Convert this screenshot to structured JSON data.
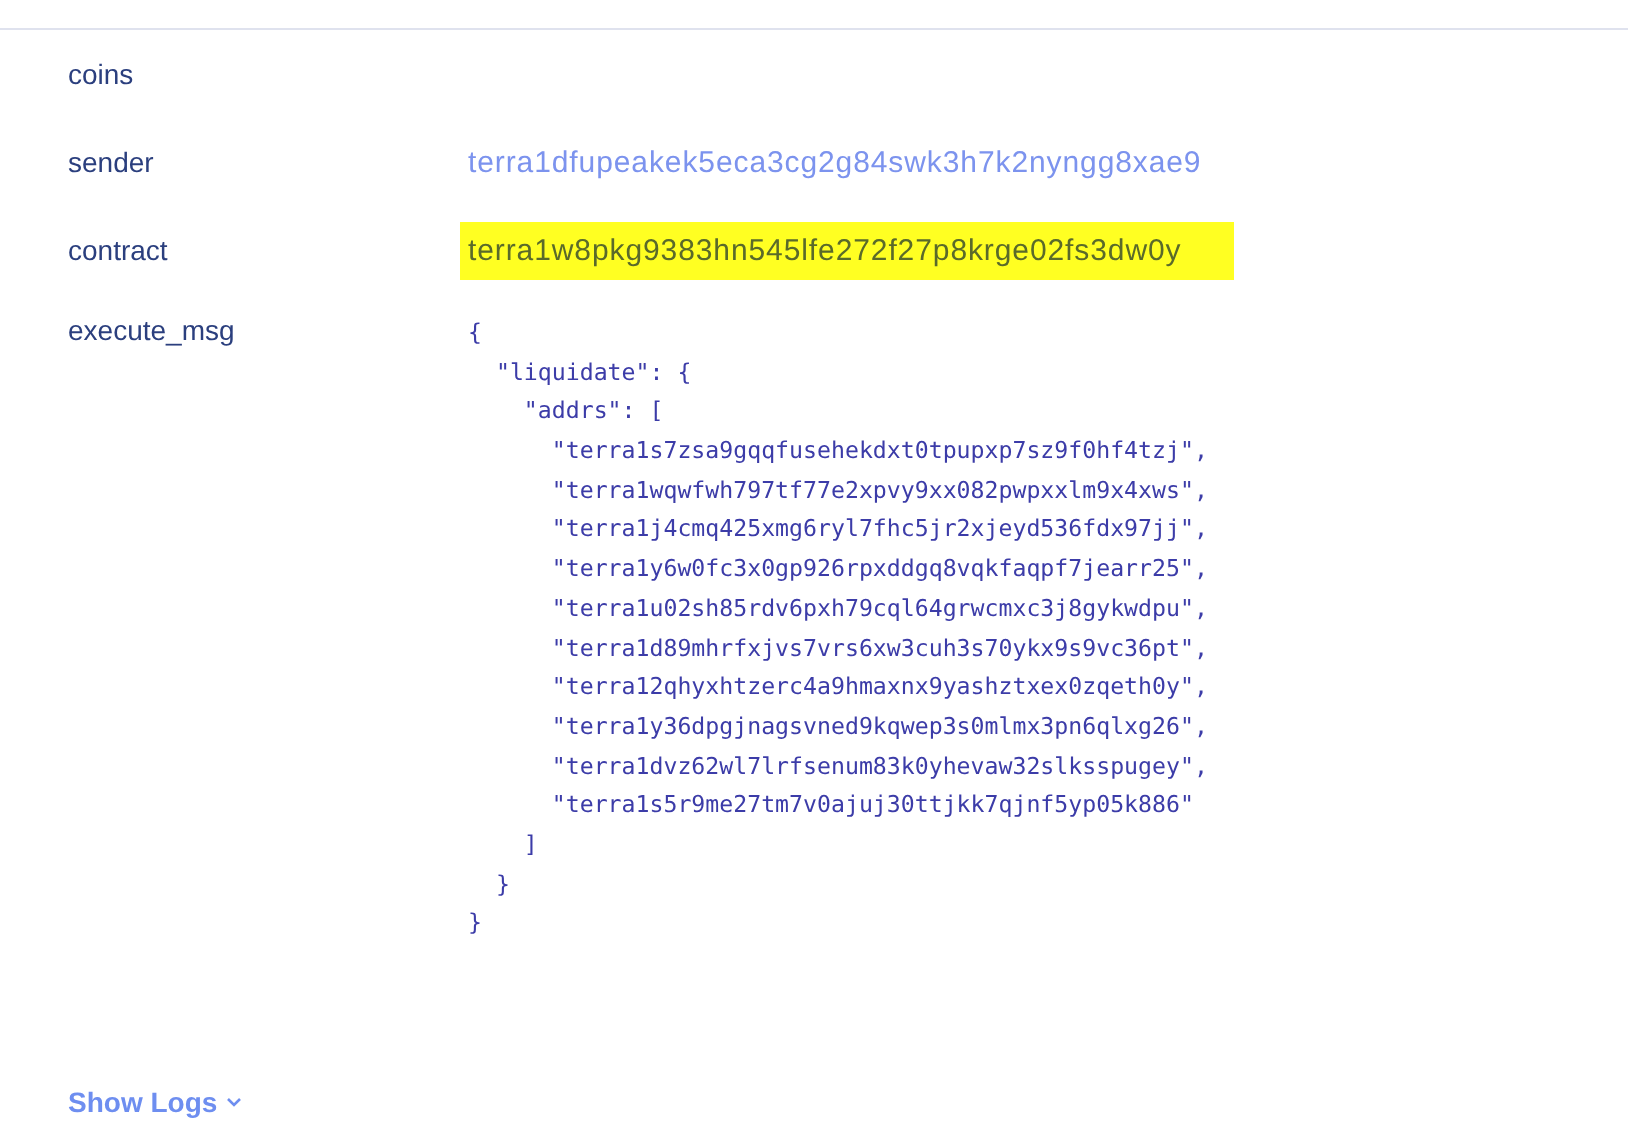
{
  "fields": [
    {
      "kind": "text",
      "label": "coins"
    },
    {
      "kind": "text",
      "label": "sender",
      "value": "terra1dfupeakek5eca3cg2g84swk3h7k2nyngg8xae9"
    },
    {
      "kind": "text",
      "label": "contract",
      "value": "terra1w8pkg9383hn545lfe272f27p8krge02fs3dw0y",
      "highlighted": true
    },
    {
      "kind": "code",
      "label": "execute_msg",
      "lines": [
        "{",
        "  \"liquidate\": {",
        "    \"addrs\": [",
        "      \"terra1s7zsa9gqqfusehekdxt0tpupxp7sz9f0hf4tzj\",",
        "      \"terra1wqwfwh797tf77e2xpvy9xx082pwpxxlm9x4xws\",",
        "      \"terra1j4cmq425xmg6ryl7fhc5jr2xjeyd536fdx97jj\",",
        "      \"terra1y6w0fc3x0gp926rpxddgq8vqkfaqpf7jearr25\",",
        "      \"terra1u02sh85rdv6pxh79cql64grwcmxc3j8gykwdpu\",",
        "      \"terra1d89mhrfxjvs7vrs6xw3cuh3s70ykx9s9vc36pt\",",
        "      \"terra12qhyxhtzerc4a9hmaxnx9yashztxex0zqeth0y\",",
        "      \"terra1y36dpgjnagsvned9kqwep3s0mlmx3pn6qlxg26\",",
        "      \"terra1dvz62wl7lrfsenum83k0yhevaw32slksspugey\",",
        "      \"terra1s5r9me27tm7v0ajuj30ttjkk7qjnf5yp05k886\"",
        "    ]",
        "  }",
        "}"
      ]
    }
  ],
  "show_logs": {
    "label": "Show Logs"
  }
}
